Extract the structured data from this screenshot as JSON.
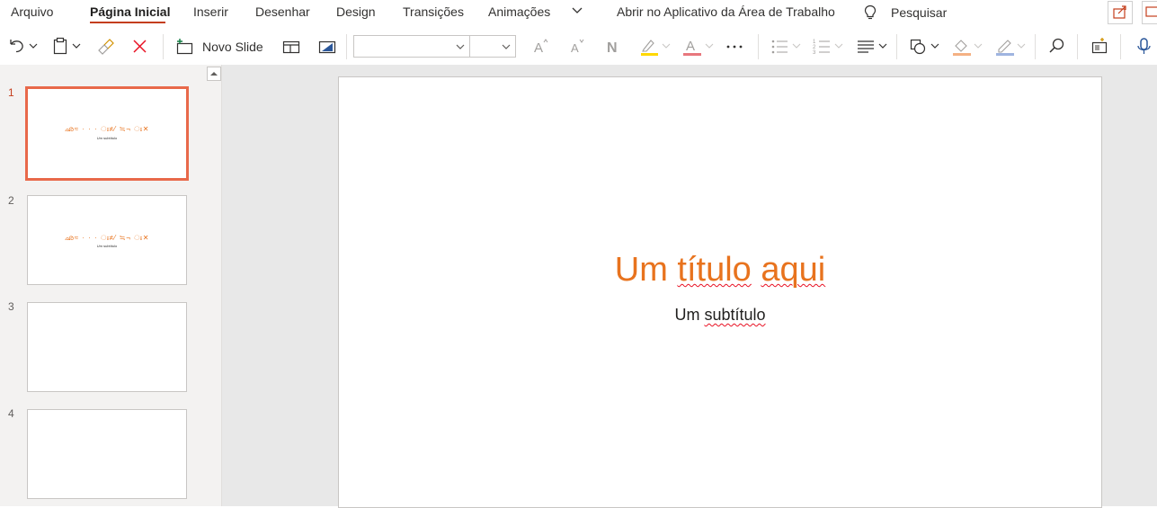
{
  "tabs": [
    {
      "label": "Arquivo"
    },
    {
      "label": "Página Inicial"
    },
    {
      "label": "Inserir"
    },
    {
      "label": "Desenhar"
    },
    {
      "label": "Design"
    },
    {
      "label": "Transições"
    },
    {
      "label": "Animações"
    }
  ],
  "open_desktop_label": "Abrir no Aplicativo da Área de Trabalho",
  "search_label": "Pesquisar",
  "ribbon": {
    "new_slide_label": "Novo Slide",
    "font_name": "",
    "font_size": ""
  },
  "slides": [
    {
      "number": "1",
      "title_glyphs": "ഛ≈ · · · ഃ≠⁄ ≒¬ ഃ✕",
      "subtitle": "Um subtítulo"
    },
    {
      "number": "2",
      "title_glyphs": "ഛ≈ · · · ഃ≠⁄ ≒¬ ഃ✕",
      "subtitle": "Um subtítulo"
    },
    {
      "number": "3"
    },
    {
      "number": "4"
    }
  ],
  "current_slide": {
    "title_part1": "Um ",
    "title_part2": "título",
    "title_part3": " ",
    "title_part4": "aqui",
    "subtitle_part1": "Um ",
    "subtitle_part2": "subtítulo"
  },
  "colors": {
    "accent": "#c43e1c",
    "title_orange": "#e8731e",
    "selected_border": "#e8694a"
  }
}
